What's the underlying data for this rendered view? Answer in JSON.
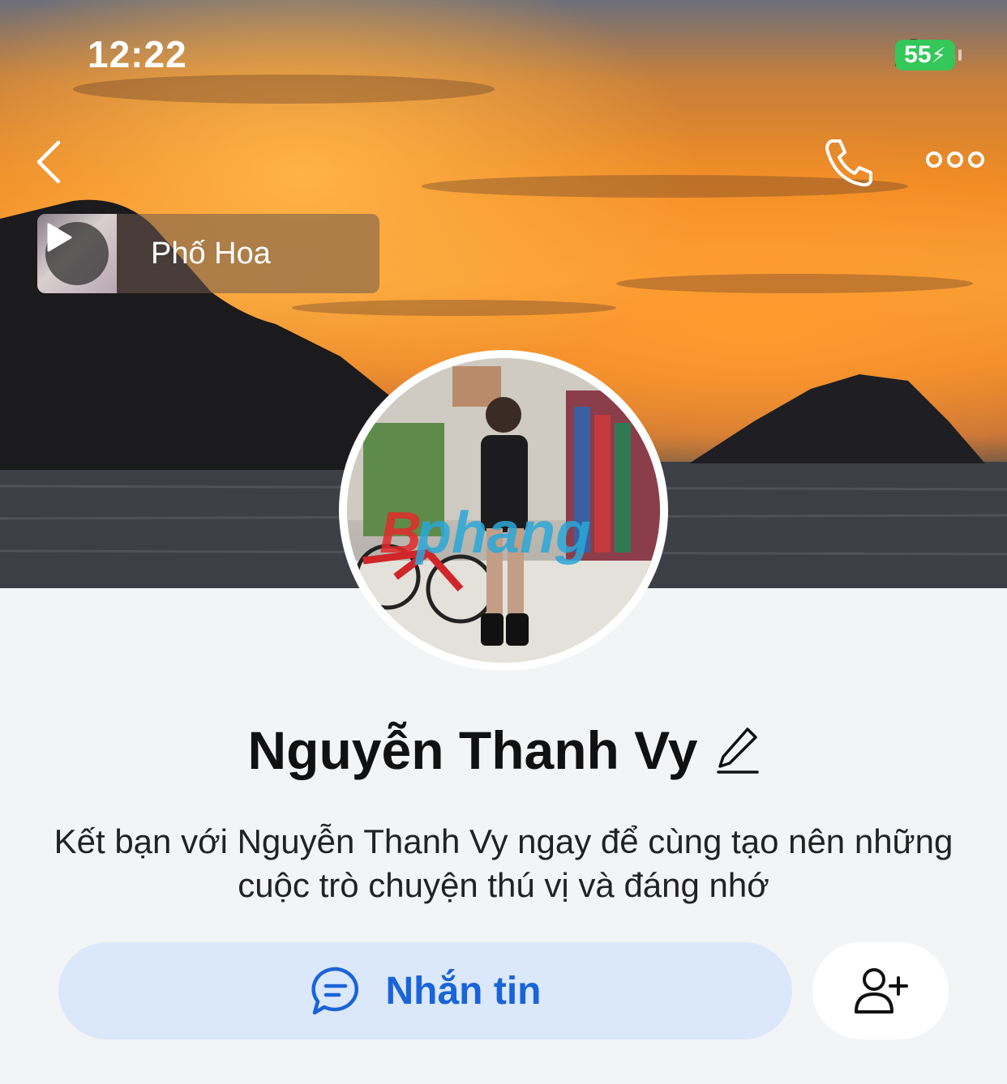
{
  "status_bar": {
    "time": "12:22",
    "battery": "55"
  },
  "icons": {
    "back": "chevron-left-icon",
    "call": "phone-icon",
    "more": "more-dots-icon",
    "play": "play-icon",
    "edit": "pencil-icon",
    "message": "chat-bubble-icon",
    "add_friend": "add-user-icon"
  },
  "music": {
    "title": "Phố Hoa"
  },
  "profile": {
    "name": "Nguyễn Thanh Vy",
    "description": "Kết bạn với Nguyễn Thanh Vy ngay để cùng tạo nên những cuộc trò chuyện thú vị và đáng nhớ",
    "avatar_watermark": "phang"
  },
  "actions": {
    "message_label": "Nhắn tin"
  },
  "colors": {
    "accent": "#1a63d9",
    "message_bg": "#dbe8fb",
    "battery": "#34c759",
    "page_bg": "#f3f4f6"
  }
}
